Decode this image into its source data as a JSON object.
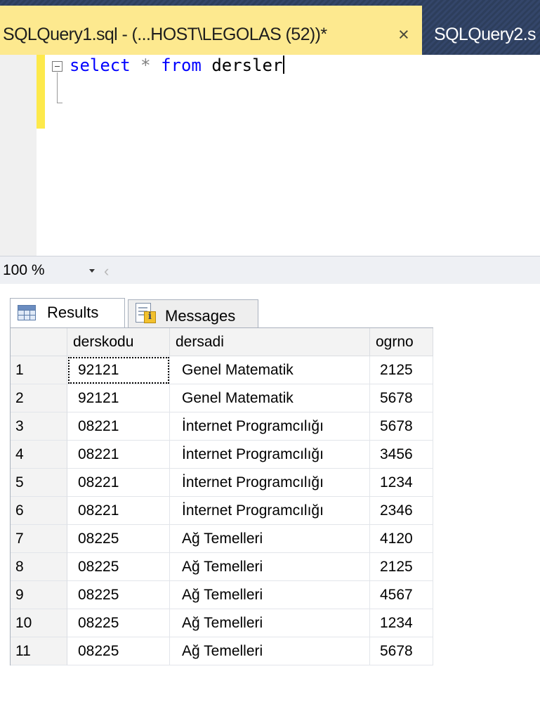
{
  "tabs": {
    "active": {
      "label": "SQLQuery1.sql - (...HOST\\LEGOLAS (52))*",
      "close": "×"
    },
    "inactive": {
      "label": "SQLQuery2.s"
    }
  },
  "editor": {
    "code": {
      "keyword_select": "select",
      "star": "*",
      "keyword_from": "from",
      "table": "dersler"
    },
    "colors": {
      "keyword": "#0000ff",
      "operator": "#808080",
      "change_bar": "#fde94b"
    }
  },
  "zoom": {
    "value": "100 %"
  },
  "result_tabs": {
    "results": "Results",
    "messages": "Messages"
  },
  "grid": {
    "columns": [
      "derskodu",
      "dersadi",
      "ogrno"
    ],
    "rows": [
      {
        "n": "1",
        "derskodu": "92121",
        "dersadi": "Genel Matematik",
        "ogrno": "2125"
      },
      {
        "n": "2",
        "derskodu": "92121",
        "dersadi": "Genel Matematik",
        "ogrno": "5678"
      },
      {
        "n": "3",
        "derskodu": "08221",
        "dersadi": "İnternet Programcılığı",
        "ogrno": "5678"
      },
      {
        "n": "4",
        "derskodu": "08221",
        "dersadi": "İnternet Programcılığı",
        "ogrno": "3456"
      },
      {
        "n": "5",
        "derskodu": "08221",
        "dersadi": "İnternet Programcılığı",
        "ogrno": "1234"
      },
      {
        "n": "6",
        "derskodu": "08221",
        "dersadi": "İnternet Programcılığı",
        "ogrno": "2346"
      },
      {
        "n": "7",
        "derskodu": "08225",
        "dersadi": "Ağ Temelleri",
        "ogrno": "4120"
      },
      {
        "n": "8",
        "derskodu": "08225",
        "dersadi": "Ağ Temelleri",
        "ogrno": "2125"
      },
      {
        "n": "9",
        "derskodu": "08225",
        "dersadi": "Ağ Temelleri",
        "ogrno": "4567"
      },
      {
        "n": "10",
        "derskodu": "08225",
        "dersadi": "Ağ Temelleri",
        "ogrno": "1234"
      },
      {
        "n": "11",
        "derskodu": "08225",
        "dersadi": "Ağ Temelleri",
        "ogrno": "5678"
      }
    ]
  }
}
